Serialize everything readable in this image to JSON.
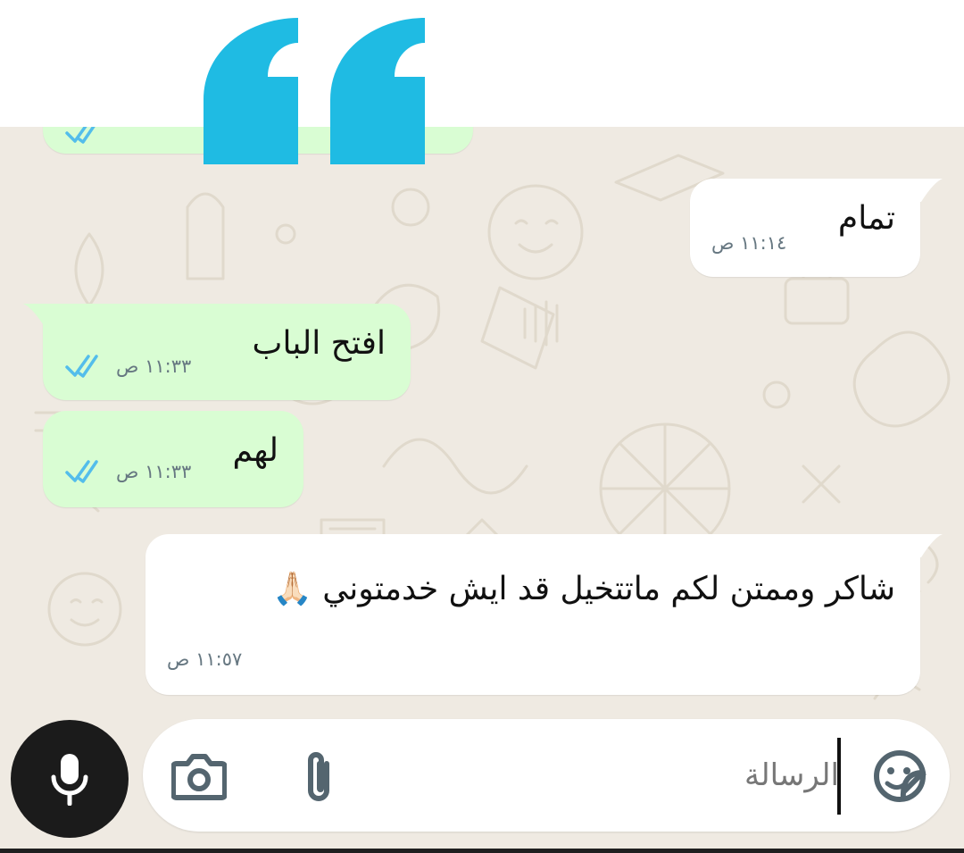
{
  "colors": {
    "chat_background": "#efeae2",
    "incoming_bubble": "#ffffff",
    "outgoing_bubble": "#d9fdd3",
    "read_ticks": "#53bdeb",
    "quote_overlay": "#1fbbe3",
    "mic_button": "#1b1b1b"
  },
  "overlay": {
    "quote_icon": "quote-icon"
  },
  "messages": [
    {
      "direction": "incoming",
      "text": "تمام",
      "time": "١١:١٤ ص"
    },
    {
      "direction": "outgoing",
      "text": "افتح الباب",
      "time": "١١:٣٣ ص",
      "status": "read"
    },
    {
      "direction": "outgoing",
      "text": "لهم",
      "time": "١١:٣٣ ص",
      "status": "read"
    },
    {
      "direction": "incoming",
      "text": "شاكر وممتن لكم ماتتخيل قد ايش خدمتوني 🙏🏻",
      "time": "١١:٥٧ ص"
    }
  ],
  "composer": {
    "placeholder": "الرسالة",
    "value": "",
    "icons": {
      "emoji": "sticker-icon",
      "attach": "paperclip-icon",
      "camera": "camera-icon",
      "mic": "microphone-icon"
    }
  }
}
